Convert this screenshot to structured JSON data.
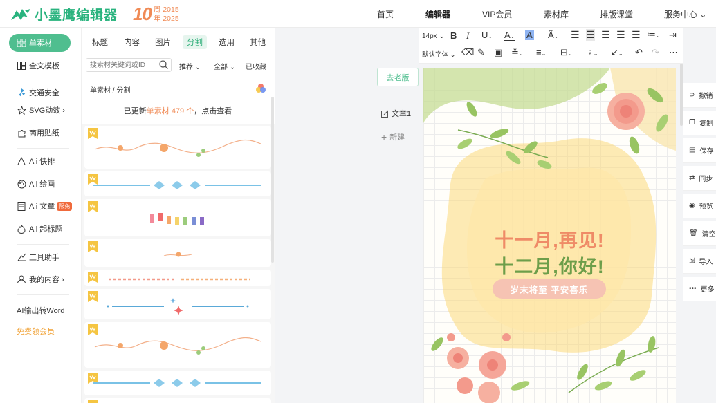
{
  "logo": {
    "name": "小墨鹰编辑器"
  },
  "anniversary": {
    "number": "10",
    "line1": "周 2015",
    "line2": "年 2025"
  },
  "topnav": [
    "首页",
    "编辑器",
    "VIP会员",
    "素材库",
    "排版课堂",
    "服务中心 ⌄"
  ],
  "sidebar": {
    "active": "单素材",
    "items": [
      "全文模板",
      "交通安全",
      "SVG动效 ›",
      "商用贴纸",
      "A i 快排",
      "A i 绘画",
      "A i 文章",
      "A i 起标题",
      "工具助手",
      "我的内容 ›",
      "AI输出转Word",
      "免费领会员"
    ],
    "badge": "限免"
  },
  "panel": {
    "tabs": [
      "标题",
      "内容",
      "图片",
      "分割",
      "选用",
      "其他"
    ],
    "search_placeholder": "搜索材关键词或ID",
    "filters": [
      "推荐 ⌄",
      "全部 ⌄",
      "已收藏"
    ],
    "breadcrumb": "单素材 / 分割",
    "notice_pre": "已更新",
    "notice_hl": "单素材 479 个",
    "notice_post": "，点击查看"
  },
  "docs": {
    "old_version": "去老版",
    "doc1": "文章1",
    "new": "新建"
  },
  "toolbar": {
    "font_size": "14px ⌄",
    "font_family": "默认字体 ⌄"
  },
  "article": {
    "title1": "十一月,再见!",
    "title2": "十二月,你好!",
    "subtitle": "岁末将至 平安喜乐"
  },
  "rightbar": [
    "撤销",
    "复制",
    "保存",
    "同步",
    "预览",
    "清空",
    "导入",
    "更多"
  ],
  "colors": {
    "brand": "#29b37e",
    "accent": "#f08a55"
  }
}
